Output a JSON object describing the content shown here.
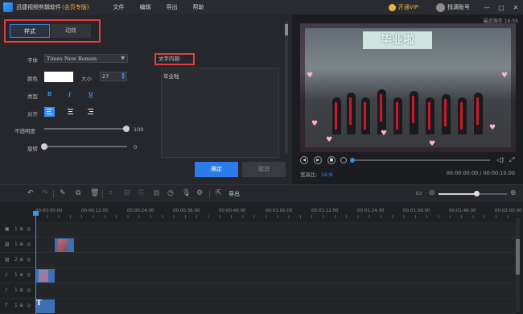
{
  "titlebar": {
    "app_title": "迅捷视频剪辑软件",
    "edition": "(会员专版)",
    "menu": [
      "文件",
      "编辑",
      "导出",
      "帮助"
    ],
    "vip_label": "开通VIP",
    "account_label": "找滴账号",
    "window_buttons": [
      "—",
      "□",
      "✕"
    ]
  },
  "edit_panel": {
    "tabs": [
      {
        "label": "样式",
        "active": true
      },
      {
        "label": "动效",
        "active": false
      }
    ],
    "font_label": "字体",
    "font_value": "Times New Roman",
    "color_label": "颜色",
    "color_value": "#ffffff",
    "size_label": "大小",
    "size_value": "27",
    "type_label": "类型",
    "type_bold": "B",
    "type_italic": "I",
    "type_underline": "U",
    "align_label": "对齐",
    "opacity_label": "不透明度",
    "opacity_value": "100",
    "rotation_label": "旋转",
    "rotation_value": "0",
    "text_content_label": "文字内容:",
    "text_content_value": "毕业啦",
    "ok_label": "确定",
    "cancel_label": "取消"
  },
  "preview": {
    "recent_save": "最近保存 16:55",
    "banner_text": "毕业啦",
    "aspect_label": "宽高比:",
    "aspect_value": "16:9",
    "timecode": "00:00:00.00 / 00:00:10.00",
    "progress": 0
  },
  "timeline_toolbar": {
    "export_label": "导出",
    "zoom_level": 0.55
  },
  "timeline": {
    "ruler_labels": [
      "00:00:00.00",
      "00:00:12.00",
      "00:00:24.00",
      "00:00:36.00",
      "00:00:48.00",
      "00:01:00.00",
      "00:01:12.00",
      "00:01:24.00",
      "00:01:36.00",
      "00:01:48.00",
      "00:02:00.00"
    ],
    "tracks": [
      "1",
      "1",
      "2",
      "1",
      "1",
      "2",
      "1"
    ]
  },
  "colors": {
    "accent": "#2b7be8",
    "highlight_box": "#e0403a",
    "vip": "#f2b23a"
  }
}
